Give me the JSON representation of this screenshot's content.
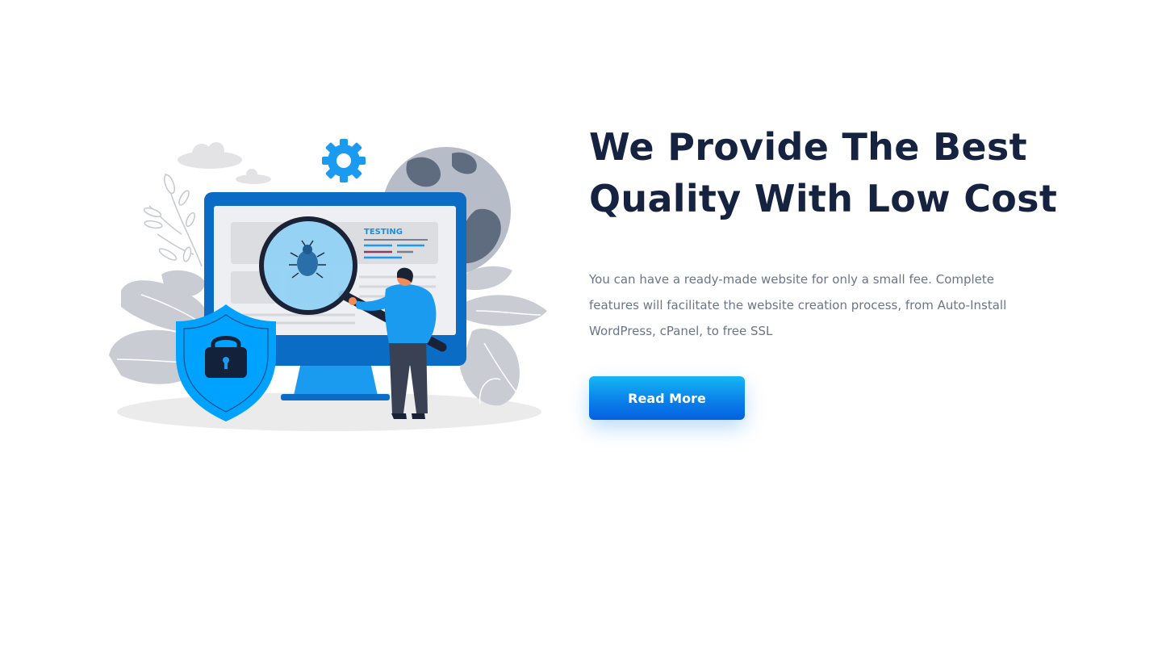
{
  "hero": {
    "headline_line1": "We Provide The Best",
    "headline_line2": "Quality With Low Cost",
    "description": "You can have a ready-made website for only a small fee. Complete features will facilitate the website creation process, from Auto-Install WordPress, cPanel, to free SSL",
    "button_label": "Read More"
  },
  "illustration": {
    "screen_label": "TESTING"
  },
  "colors": {
    "headline": "#152341",
    "body_text": "#6b7488",
    "accent_blue": "#0a7de9",
    "bright_blue": "#00a2ff",
    "monitor_frame": "#0a6cc4"
  }
}
